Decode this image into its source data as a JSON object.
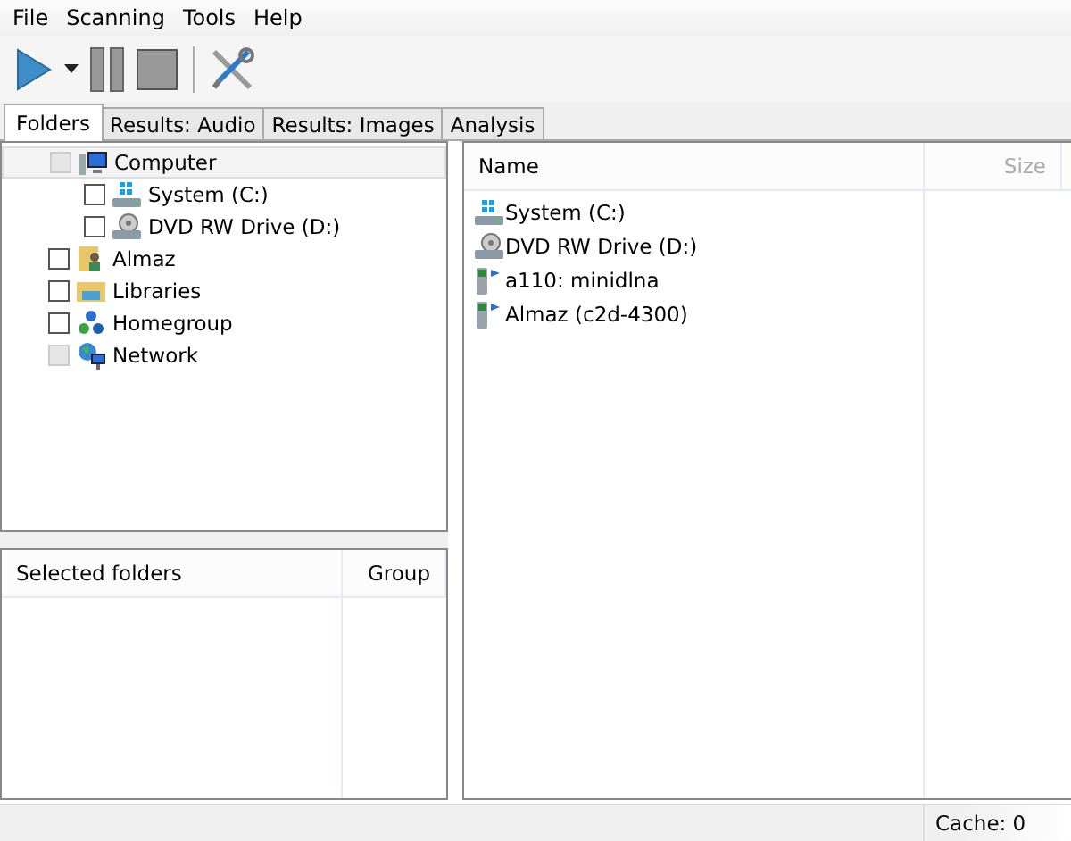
{
  "menu": [
    "File",
    "Scanning",
    "Tools",
    "Help"
  ],
  "toolbar": [
    {
      "kind": "play"
    },
    {
      "kind": "dropdown"
    },
    {
      "kind": "pause"
    },
    {
      "kind": "stop"
    },
    {
      "kind": "settings"
    }
  ],
  "tabs": [
    {
      "label": "Folders",
      "selected": true
    },
    {
      "label": "Results: Audio",
      "selected": false
    },
    {
      "label": "Results: Images",
      "selected": false
    },
    {
      "label": "Analysis",
      "selected": false
    }
  ],
  "tree": [
    {
      "label": "Computer",
      "kind": "computer",
      "checked": false,
      "disabled": true,
      "selected": true,
      "children": [
        {
          "label": "System (C:)",
          "kind": "drive",
          "checked": false,
          "disabled": false,
          "selected": false
        },
        {
          "label": "DVD RW Drive (D:)",
          "kind": "optical",
          "checked": false,
          "disabled": false,
          "selected": false
        }
      ]
    },
    {
      "label": "Almaz",
      "kind": "userfolder",
      "checked": false,
      "disabled": false,
      "selected": false
    },
    {
      "label": "Libraries",
      "kind": "library",
      "checked": false,
      "disabled": false,
      "selected": false
    },
    {
      "label": "Homegroup",
      "kind": "homegroup",
      "checked": false,
      "disabled": false,
      "selected": false
    },
    {
      "label": "Network",
      "kind": "network",
      "checked": false,
      "disabled": true,
      "selected": false
    }
  ],
  "selected_folders": {
    "columns": [
      "Selected folders",
      "Group"
    ]
  },
  "file_list": {
    "columns": [
      "Name",
      "Size"
    ],
    "rows": [
      {
        "name": "System (C:)",
        "kind": "drive"
      },
      {
        "name": "DVD RW Drive (D:)",
        "kind": "optical"
      },
      {
        "name": "a110: minidlna",
        "kind": "mediaserver"
      },
      {
        "name": "Almaz (c2d-4300)",
        "kind": "mediaserver"
      }
    ]
  },
  "status_bar": {
    "cache": "Cache: 0"
  }
}
